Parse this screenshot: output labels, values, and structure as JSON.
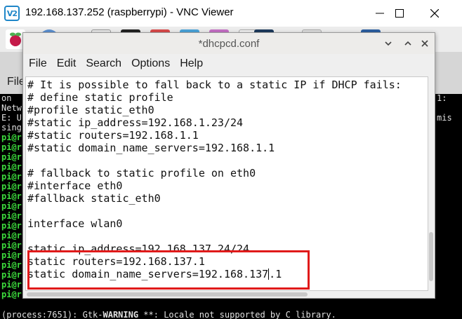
{
  "vnc": {
    "title": "192.168.137.252 (raspberrypi) - VNC Viewer",
    "logo_text": "V2",
    "controls": {
      "minimize": "—",
      "maximize": "☐",
      "close": "✕"
    }
  },
  "desktop": {
    "taskbar_icons": [
      "raspberry-menu-icon",
      "browser-icon",
      "file-manager-icon",
      "terminal-icon",
      "app-icon",
      "app-icon",
      "app-icon",
      "app-icon",
      "app-icon",
      "app-icon",
      "app-icon"
    ],
    "terminal_menu_label": "File",
    "terminal": {
      "left_lines": [
        "on",
        "Netw",
        "E: U",
        "sing",
        "pi@r",
        "pi@r",
        "pi@r",
        "pi@r",
        "pi@r",
        "pi@r",
        "pi@r",
        "pi@r",
        "pi@r",
        "pi@r",
        "pi@r",
        "pi@r",
        "pi@r",
        "pi@r",
        "pi@r",
        "pi@r",
        "pi@r"
      ],
      "right_lines": [
        "1:",
        "",
        "mis"
      ],
      "bottom_line_prefix": "(process:7651): Gtk-",
      "bottom_line_warning": "WARNING",
      "bottom_line_suffix": " **: Locale not supported by C library."
    }
  },
  "editor": {
    "title": "*dhcpcd.conf",
    "menu": [
      "File",
      "Edit",
      "Search",
      "Options",
      "Help"
    ],
    "lines": [
      "# It is possible to fall back to a static IP if DHCP fails:",
      "# define static profile",
      "#profile static_eth0",
      "#static ip_address=192.168.1.23/24",
      "#static routers=192.168.1.1",
      "#static domain_name_servers=192.168.1.1",
      "",
      "# fallback to static profile on eth0",
      "#interface eth0",
      "#fallback static_eth0",
      "",
      "interface wlan0",
      "",
      "static ip_address=192.168.137.24/24",
      "static routers=192.168.137.1",
      "static domain_name_servers=192.168.137"
    ],
    "cursor_tail": ".1",
    "colors": {
      "highlight": "#e01a1a"
    }
  }
}
